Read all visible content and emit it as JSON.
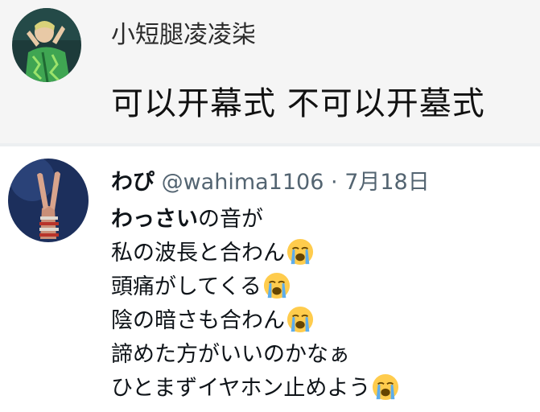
{
  "chat": {
    "user_name": "小短腿凌凌柒",
    "message": "可以开幕式 不可以开墓式"
  },
  "tweet": {
    "display_name": "わぴ",
    "handle": "@wahima1106",
    "separator": "·",
    "date": "7月18日",
    "lines": [
      {
        "bold": "わっさい",
        "text": "の音が",
        "emoji": ""
      },
      {
        "bold": "",
        "text": "私の波長と合わん",
        "emoji": "loudly-crying-face-icon"
      },
      {
        "bold": "",
        "text": "頭痛がしてくる",
        "emoji": "loudly-crying-face-icon"
      },
      {
        "bold": "",
        "text": "陰の暗さも合わん",
        "emoji": "loudly-crying-face-icon"
      },
      {
        "bold": "",
        "text": "諦めた方がいいのかなぁ",
        "emoji": ""
      },
      {
        "bold": "",
        "text": "ひとまずイヤホン止めよう",
        "emoji": "loudly-crying-face-icon"
      }
    ]
  },
  "colors": {
    "top_background": "#f5f5f5",
    "divider": "#eceff1",
    "secondary_text": "#536471",
    "primary_text": "#0f1419"
  }
}
